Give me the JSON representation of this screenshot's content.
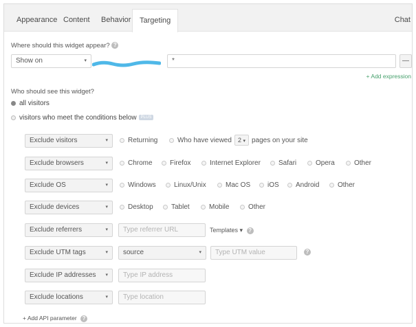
{
  "tabs": [
    {
      "label": "Appearance"
    },
    {
      "label": "Content"
    },
    {
      "label": "Behavior"
    },
    {
      "label": "Targeting"
    }
  ],
  "chat_tab": "Chat",
  "where": {
    "label": "Where should this widget appear?",
    "mode": "Show on",
    "expression": "*",
    "remove_label": "—",
    "add_expression": "+ Add expression"
  },
  "who": {
    "label": "Who should see this widget?",
    "all_visitors": "all visitors",
    "conditional": "visitors who meet the conditions below",
    "plus_badge": "PLUS"
  },
  "rules": {
    "visitors": {
      "select": "Exclude visitors",
      "returning": "Returning",
      "viewed_prefix": "Who have viewed",
      "viewed_count": "2",
      "viewed_suffix": "pages on your site"
    },
    "browsers": {
      "select": "Exclude browsers",
      "options": [
        "Chrome",
        "Firefox",
        "Internet Explorer",
        "Safari",
        "Opera",
        "Other"
      ]
    },
    "os": {
      "select": "Exclude OS",
      "options": [
        "Windows",
        "Linux/Unix",
        "Mac OS",
        "iOS",
        "Android",
        "Other"
      ]
    },
    "devices": {
      "select": "Exclude devices",
      "options": [
        "Desktop",
        "Tablet",
        "Mobile",
        "Other"
      ]
    },
    "referrers": {
      "select": "Exclude referrers",
      "placeholder": "Type referrer URL",
      "templates": "Templates ▾"
    },
    "utm": {
      "select": "Exclude UTM tags",
      "source": "source",
      "placeholder": "Type UTM value"
    },
    "ip": {
      "select": "Exclude IP addresses",
      "placeholder": "Type IP address"
    },
    "locations": {
      "select": "Exclude locations",
      "placeholder": "Type location"
    }
  },
  "add_api": "+ Add API parameter",
  "icons": {
    "caret": "▾",
    "help": "?"
  },
  "colors": {
    "link_green": "#46a06c",
    "redaction_blue": "#4fb8e8"
  }
}
